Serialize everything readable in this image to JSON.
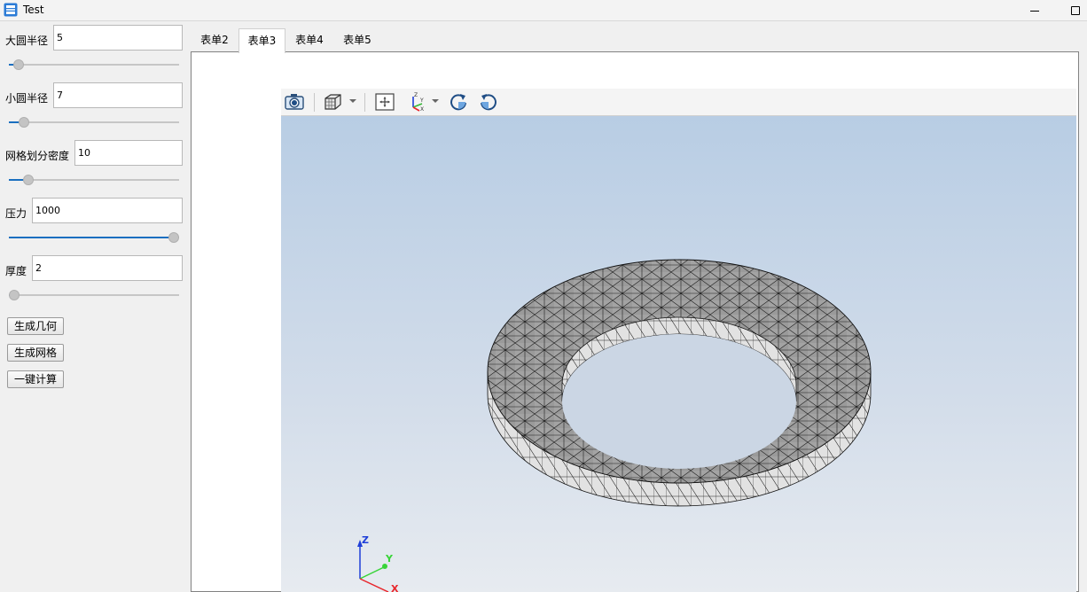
{
  "window": {
    "title": "Test"
  },
  "params": [
    {
      "label": "大圆半径",
      "value": "5",
      "slider_fraction": 0.03
    },
    {
      "label": "小圆半径",
      "value": "7",
      "slider_fraction": 0.06
    },
    {
      "label": "网格划分密度",
      "value": "10",
      "slider_fraction": 0.09
    },
    {
      "label": "压力",
      "value": "1000",
      "slider_fraction": 1.0
    },
    {
      "label": "厚度",
      "value": "2",
      "slider_fraction": 0.0
    }
  ],
  "buttons": {
    "generate_geometry": "生成几何",
    "generate_mesh": "生成网格",
    "one_click_compute": "一键计算"
  },
  "tabs": [
    {
      "label": "表单2",
      "active": false
    },
    {
      "label": "表单3",
      "active": true
    },
    {
      "label": "表单4",
      "active": false
    },
    {
      "label": "表单5",
      "active": false
    }
  ],
  "viewer": {
    "toolbar": [
      "camera-icon",
      "view-cube-icon",
      "fit-all-icon",
      "axes-icon",
      "rotate-cw-icon",
      "rotate-ccw-icon"
    ],
    "axes": {
      "z": "Z",
      "y": "Y",
      "x": "X"
    },
    "colors": {
      "mesh_top": "#9a9a9a",
      "mesh_side": "#e3e3e3",
      "edge": "#1a1a1a",
      "axis_x": "#e8262c",
      "axis_y": "#38d438",
      "axis_z": "#1f3fd8"
    }
  }
}
